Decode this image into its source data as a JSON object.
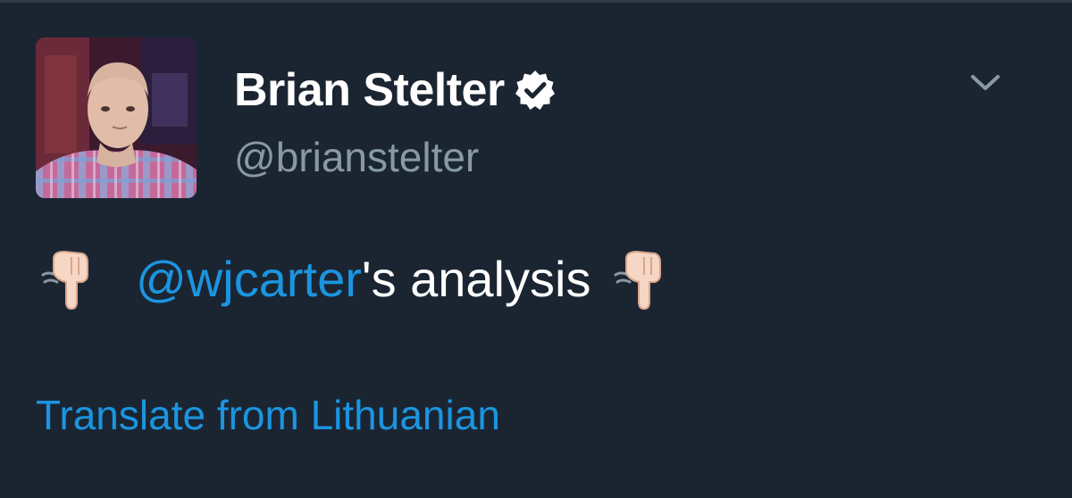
{
  "tweet": {
    "author": {
      "display_name": "Brian Stelter",
      "handle": "@brianstelter",
      "verified": true
    },
    "text": {
      "mention": "@wjcarter",
      "rest": "'s analysis",
      "emoji": "backhand-index-pointing-down"
    },
    "translate_link": "Translate from Lithuanian"
  },
  "colors": {
    "background": "#1b2532",
    "primary_text": "#ffffff",
    "secondary_text": "#8899a6",
    "link": "#1b95e0"
  },
  "icons": {
    "verified": "verified-badge-icon",
    "menu": "chevron-down-icon",
    "emoji": "pointing-down-hand-icon"
  }
}
